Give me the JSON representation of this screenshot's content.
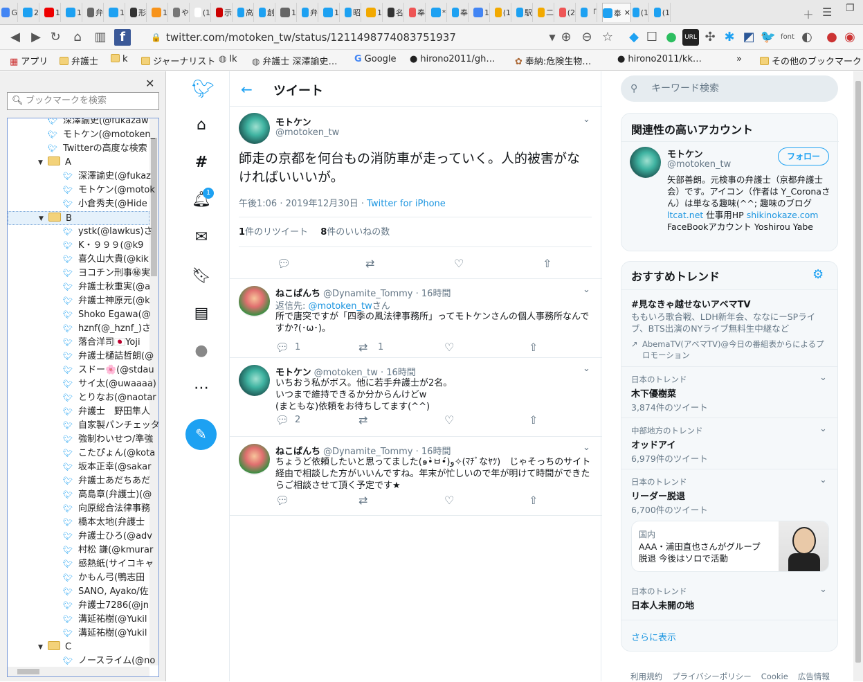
{
  "browser": {
    "tabs": [
      "G",
      "2",
      "1",
      "1",
      "弁",
      "1",
      "形",
      "1",
      "や",
      "(1",
      "示",
      "高",
      "創",
      "1",
      "弁",
      "1",
      "昭",
      "1",
      "名",
      "奉",
      "*",
      "奉",
      "1",
      "(1",
      "駅",
      "二",
      "(2",
      "「",
      "奉",
      "(1",
      "(1"
    ],
    "url": "twitter.com/motoken_tw/status/1211498774083751937",
    "bookmarks": [
      "アプリ",
      "弁護士",
      "k",
      "ジャーナリスト",
      "lk",
      "弁護士 深澤諭史…",
      "Google",
      "hirono2011/gh…",
      "奉納:危険生物…",
      "hirono2011/kk…",
      "»",
      "その他のブックマーク"
    ]
  },
  "sidebar": {
    "search_placeholder": "ブックマークを検索",
    "items": [
      {
        "label": "深澤諭史(@fukazaw",
        "indent": 2,
        "type": "bird"
      },
      {
        "label": "モトケン(@motoken_",
        "indent": 2,
        "type": "bird"
      },
      {
        "label": "Twitterの高度な検索",
        "indent": 2,
        "type": "bird"
      },
      {
        "label": "A",
        "indent": 1,
        "type": "folder"
      },
      {
        "label": "深澤諭史(@fukaz",
        "indent": 3,
        "type": "bird"
      },
      {
        "label": "モトケン(@motok",
        "indent": 3,
        "type": "bird"
      },
      {
        "label": "小倉秀夫(@Hide",
        "indent": 3,
        "type": "bird"
      },
      {
        "label": "B",
        "indent": 1,
        "type": "folder"
      },
      {
        "label": "ystk(@lawkus)さ",
        "indent": 3,
        "type": "bird"
      },
      {
        "label": "K・９９９(@k9",
        "indent": 3,
        "type": "bird"
      },
      {
        "label": "喜久山大貴(@kik",
        "indent": 3,
        "type": "bird"
      },
      {
        "label": "ヨコチン刑事㊙実",
        "indent": 3,
        "type": "bird"
      },
      {
        "label": "弁護士秋重実(@a",
        "indent": 3,
        "type": "bird"
      },
      {
        "label": "弁護士神原元(@k",
        "indent": 3,
        "type": "bird"
      },
      {
        "label": "Shoko Egawa(@",
        "indent": 3,
        "type": "bird"
      },
      {
        "label": "hznf(@_hznf_)さ",
        "indent": 3,
        "type": "bird"
      },
      {
        "label": "落合洋司🇯🇵Yoji",
        "indent": 3,
        "type": "bird"
      },
      {
        "label": "弁護士樋詰哲朗(@",
        "indent": 3,
        "type": "bird"
      },
      {
        "label": "スドー🌸(@stdau",
        "indent": 3,
        "type": "bird"
      },
      {
        "label": "サイ太(@uwaaaa)",
        "indent": 3,
        "type": "bird"
      },
      {
        "label": "とりなお(@naotar",
        "indent": 3,
        "type": "bird"
      },
      {
        "label": "弁護士　野田隼人",
        "indent": 3,
        "type": "bird"
      },
      {
        "label": "自家製パンチェッタ",
        "indent": 3,
        "type": "bird"
      },
      {
        "label": "強制わいせつ/準強",
        "indent": 3,
        "type": "bird"
      },
      {
        "label": "こたぴょん(@kota",
        "indent": 3,
        "type": "bird"
      },
      {
        "label": "坂本正幸(@sakar",
        "indent": 3,
        "type": "bird"
      },
      {
        "label": "弁護士あだちあだ",
        "indent": 3,
        "type": "bird"
      },
      {
        "label": "高島章(弁護士)(@",
        "indent": 3,
        "type": "bird"
      },
      {
        "label": "向原総合法律事務",
        "indent": 3,
        "type": "bird"
      },
      {
        "label": "橋本太地(弁護士",
        "indent": 3,
        "type": "bird"
      },
      {
        "label": "弁護士ひろ(@adv",
        "indent": 3,
        "type": "bird"
      },
      {
        "label": "村松 謙(@kmurar",
        "indent": 3,
        "type": "bird"
      },
      {
        "label": "感熱紙(サイコキャ",
        "indent": 3,
        "type": "bird"
      },
      {
        "label": "かもん弓(鴨志田",
        "indent": 3,
        "type": "bird"
      },
      {
        "label": "SANO, Ayako/佐",
        "indent": 3,
        "type": "bird"
      },
      {
        "label": "弁護士7286(@jn",
        "indent": 3,
        "type": "bird"
      },
      {
        "label": "溝延祐樹(@Yukil",
        "indent": 3,
        "type": "bird"
      },
      {
        "label": "溝延祐樹(@Yukil",
        "indent": 3,
        "type": "bird"
      },
      {
        "label": "C",
        "indent": 1,
        "type": "folder"
      },
      {
        "label": "ノースライム(@no",
        "indent": 3,
        "type": "bird"
      }
    ]
  },
  "twitter_nav": {
    "notif_count": "1"
  },
  "tweet": {
    "header": "ツイート",
    "name": "モトケン",
    "handle": "@motoken_tw",
    "text": "師走の京都を何台もの消防車が走っていく。人的被害がなければいいいが。",
    "time": "午後1:06 · 2019年12月30日",
    "source": "Twitter for iPhone",
    "retweets": "1",
    "retweets_label": "件のリツイート",
    "likes": "8",
    "likes_label": "件のいいねの数"
  },
  "replies": [
    {
      "name": "ねこぱんち",
      "handle": "@Dynamite_Tommy · 16時間",
      "reply_to_prefix": "返信先: ",
      "reply_to": "@motoken_tw",
      "reply_to_suffix": "さん",
      "text": "所で唐突ですが「四季の風法律事務所」ってモトケンさんの個人事務所なんですか?(･ω･)。",
      "replies": "1",
      "rts": "1"
    },
    {
      "name": "モトケン",
      "handle": "@motoken_tw · 16時間",
      "text": "いちおう私がボス。他に若手弁護士が2名。\nいつまで維持できるか分からんけどw\n(まともな)依頼をお待ちしてます(^^)",
      "replies": "2",
      "rts": ""
    },
    {
      "name": "ねこぱんち",
      "handle": "@Dynamite_Tommy · 16時間",
      "text": "ちょうど依頼したいと思ってました(๑•̀ㅂ•́)و✧(ﾏﾁﾞなﾔﾂ)　じゃそっちのサイト経由で相談した方がいいんですね。年末が忙しいので年が明けて時間ができたらご相談させて頂く予定です★",
      "replies": "",
      "rts": ""
    }
  ],
  "right": {
    "search_placeholder": "キーワード検索",
    "related_title": "関連性の高いアカウント",
    "account": {
      "name": "モトケン",
      "handle": "@motoken_tw",
      "follow": "フォロー",
      "bio": "矢部善朗。元検事の弁護士（京都弁護士会）です。アイコン（作者は Y_Coronaさん）は単なる趣味(^^; 趣味のブログ ",
      "link1": "ltcat.net",
      "bio2": " 仕事用HP ",
      "link2": "shikinokaze.com",
      "bio3": " FaceBookアカウント Yoshirou Yabe"
    },
    "trends_title": "おすすめトレンド",
    "promo": {
      "tag": "#見なきゃ越せないアベマTV",
      "desc": "ももいろ歌合戦、LDH新年会、ななにーSPライブ、BTS出演のNYライブ無料生中継など",
      "by": "AbemaTV(アベマTV)@今日の番組表からによるプロモーション"
    },
    "trends": [
      {
        "cat": "日本のトレンド",
        "name": "木下優樹菜",
        "count": "3,874件のツイート"
      },
      {
        "cat": "中部地方のトレンド",
        "name": "オッドアイ",
        "count": "6,979件のツイート"
      },
      {
        "cat": "日本のトレンド",
        "name": "リーダー脱退",
        "count": "6,700件のツイート"
      }
    ],
    "news": {
      "cat": "国内",
      "text": "AAA・浦田直也さんがグループ脱退 今後はソロで活動"
    },
    "trend4": {
      "cat": "日本のトレンド",
      "name": "日本人未開の地"
    },
    "more": "さらに表示",
    "footer": [
      "利用規約",
      "プライバシーポリシー",
      "Cookie",
      "広告情報"
    ]
  },
  "colors": {
    "twitter_blue": "#1da1f2",
    "link": "#1b95e0",
    "gray": "#657786"
  }
}
